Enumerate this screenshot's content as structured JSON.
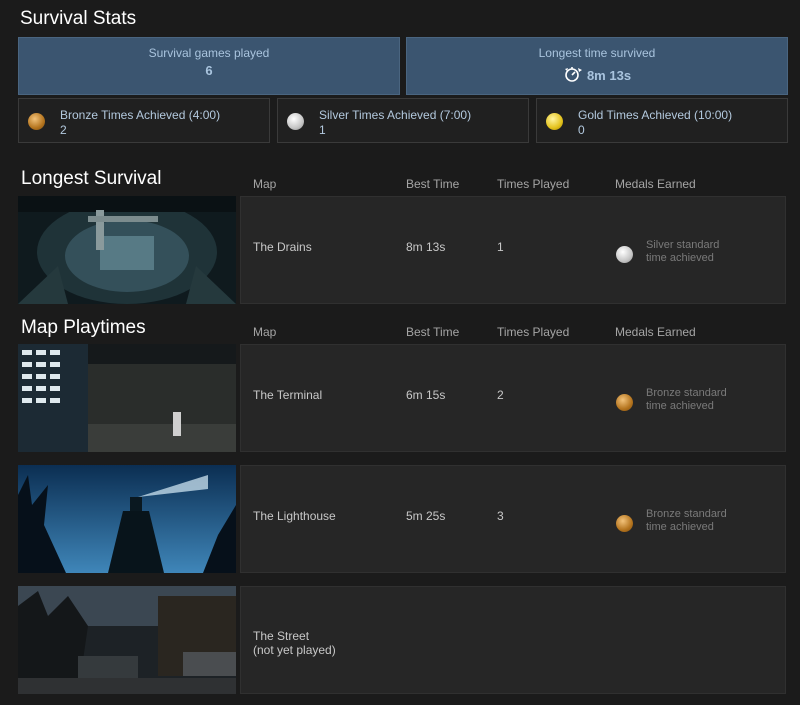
{
  "survival_stats": {
    "title": "Survival Stats",
    "games_played_label": "Survival games played",
    "games_played_value": "6",
    "longest_label": "Longest time survived",
    "longest_value": "8m 13s",
    "medals": [
      {
        "label": "Bronze Times Achieved (4:00)",
        "count": "2",
        "type": "bronze"
      },
      {
        "label": "Silver Times Achieved (7:00)",
        "count": "1",
        "type": "silver"
      },
      {
        "label": "Gold Times Achieved (10:00)",
        "count": "0",
        "type": "gold"
      }
    ]
  },
  "columns": {
    "map": "Map",
    "best_time": "Best Time",
    "times_played": "Times Played",
    "medals_earned": "Medals Earned"
  },
  "longest_survival": {
    "title": "Longest Survival",
    "row": {
      "map": "The Drains",
      "best_time": "8m 13s",
      "times_played": "1",
      "medal_type": "silver",
      "medal_note_1": "Silver standard",
      "medal_note_2": "time achieved"
    }
  },
  "map_playtimes": {
    "title": "Map Playtimes",
    "rows": [
      {
        "map": "The Terminal",
        "best_time": "6m 15s",
        "times_played": "2",
        "medal_type": "bronze",
        "medal_note_1": "Bronze standard",
        "medal_note_2": "time achieved"
      },
      {
        "map": "The Lighthouse",
        "best_time": "5m 25s",
        "times_played": "3",
        "medal_type": "bronze",
        "medal_note_1": "Bronze standard",
        "medal_note_2": "time achieved"
      },
      {
        "map": "The Street",
        "map_line2": "(not yet played)"
      }
    ]
  },
  "colors": {
    "background": "#1b1b1b",
    "stat_box": "#3b5570",
    "stat_text": "#a9c4de",
    "panel": "#262626"
  },
  "icons": {
    "stopwatch": "stopwatch-icon",
    "bronze": "bronze-medal-icon",
    "silver": "silver-medal-icon",
    "gold": "gold-medal-icon"
  }
}
